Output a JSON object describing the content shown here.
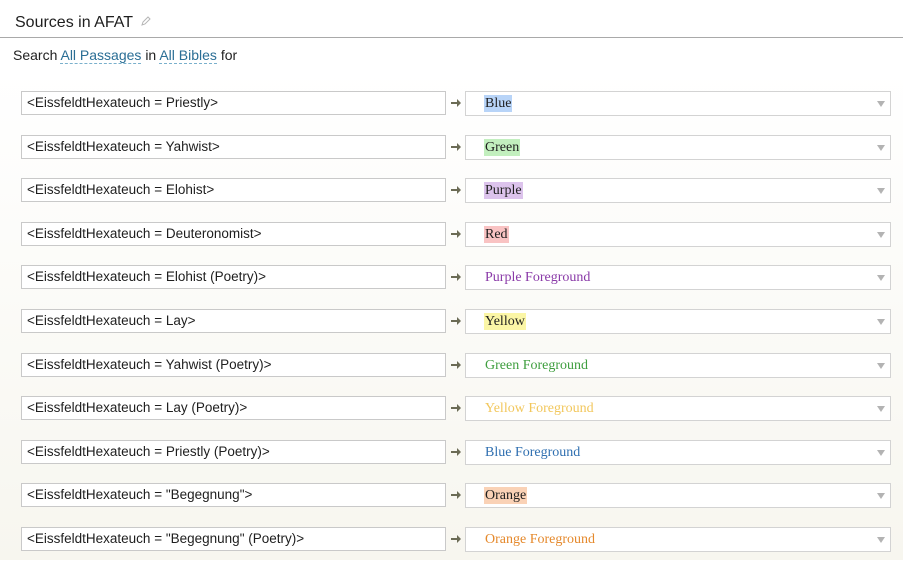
{
  "header": {
    "title": "Sources in AFAT",
    "edit_icon": "pencil-icon"
  },
  "search": {
    "prefix": "Search",
    "passages_link": "All Passages",
    "middle": "in",
    "bibles_link": "All Bibles",
    "suffix": "for"
  },
  "icons": {
    "row_arrow": "arrow-right-icon",
    "dropdown": "chevron-down-icon"
  },
  "rows": [
    {
      "query": "<EissfeldtHexateuch = Priestly>",
      "style": "Blue",
      "kind": "highlight",
      "color": "#b8d4f8"
    },
    {
      "query": "<EissfeldtHexateuch = Yahwist>",
      "style": "Green",
      "kind": "highlight",
      "color": "#c2efbe"
    },
    {
      "query": "<EissfeldtHexateuch = Elohist>",
      "style": "Purple",
      "kind": "highlight",
      "color": "#dcc3ec"
    },
    {
      "query": "<EissfeldtHexateuch = Deuteronomist>",
      "style": "Red",
      "kind": "highlight",
      "color": "#f9c3c3"
    },
    {
      "query": "<EissfeldtHexateuch = Elohist (Poetry)>",
      "style": "Purple Foreground",
      "kind": "foreground",
      "color": "#8a3aa8"
    },
    {
      "query": "<EissfeldtHexateuch = Lay>",
      "style": "Yellow",
      "kind": "highlight",
      "color": "#fbf6a6"
    },
    {
      "query": "<EissfeldtHexateuch = Yahwist (Poetry)>",
      "style": "Green Foreground",
      "kind": "foreground",
      "color": "#3f9e3f"
    },
    {
      "query": "<EissfeldtHexateuch = Lay (Poetry)>",
      "style": "Yellow Foreground",
      "kind": "foreground",
      "color": "#f2c75c"
    },
    {
      "query": "<EissfeldtHexateuch = Priestly (Poetry)>",
      "style": "Blue Foreground",
      "kind": "foreground",
      "color": "#2f6fb0"
    },
    {
      "query": "<EissfeldtHexateuch = \"Begegnung\">",
      "style": "Orange",
      "kind": "highlight",
      "color": "#fad2b6"
    },
    {
      "query": "<EissfeldtHexateuch = \"Begegnung\" (Poetry)>",
      "style": "Orange Foreground",
      "kind": "foreground",
      "color": "#e5892c"
    }
  ]
}
